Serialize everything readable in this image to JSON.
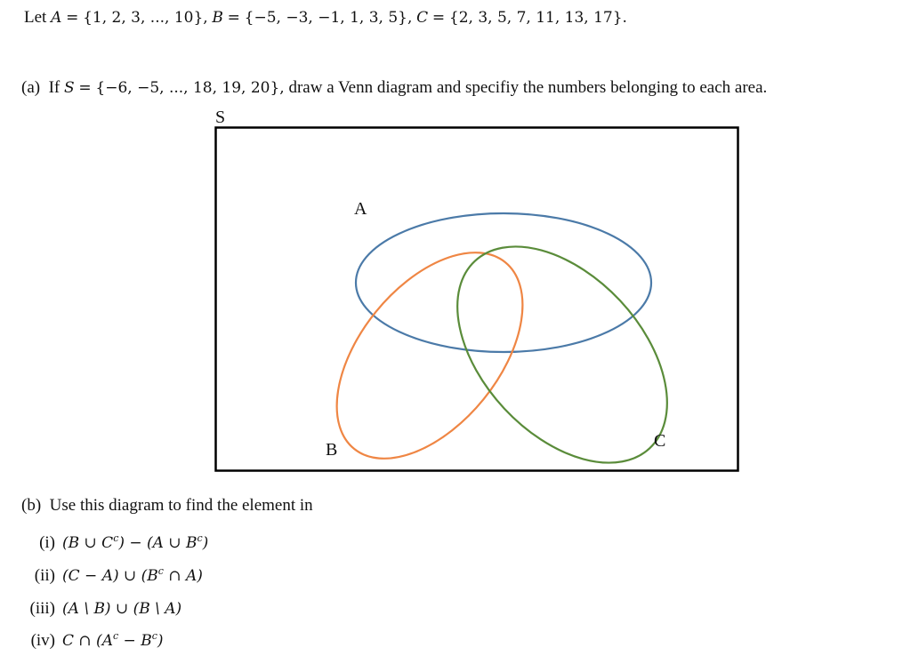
{
  "definitions": {
    "lead": "Let",
    "set_a_name": "A",
    "set_a_value": "{1, 2, 3, ..., 10},",
    "set_b_name": "B",
    "set_b_value": "{−5, −3, −1, 1, 3, 5},",
    "set_c_name": "C",
    "set_c_value": "{2, 3, 5, 7, 11, 13, 17}.",
    "equals": "="
  },
  "part_a": {
    "label": "(a)",
    "text_before": "If",
    "universe_name": "S",
    "universe_value": "{−6, −5, ..., 18, 19, 20},",
    "text_after": "draw a Venn diagram and specifiy the numbers belonging to each area."
  },
  "venn": {
    "universe_label": "S",
    "sets": [
      {
        "name": "A",
        "color": "#4b7aa8"
      },
      {
        "name": "B",
        "color": "#ef8644"
      },
      {
        "name": "C",
        "color": "#5a8c3a"
      }
    ],
    "border_color": "#000000"
  },
  "part_b": {
    "label": "(b)",
    "text": "Use this diagram to find the element in",
    "items": [
      {
        "num": "(i)",
        "expr_parts": [
          "(B ∪ C",
          "c",
          ") − (A ∪ B",
          "c",
          ")"
        ]
      },
      {
        "num": "(ii)",
        "expr_parts": [
          "(C − A) ∪ (B",
          "c",
          " ∩ A)"
        ]
      },
      {
        "num": "(iii)",
        "expr_parts": [
          "(A \\ B) ∪ (B \\ A)"
        ]
      },
      {
        "num": "(iv)",
        "expr_parts": [
          "C ∩ (A",
          "c",
          " − B",
          "c",
          ")"
        ]
      }
    ]
  }
}
